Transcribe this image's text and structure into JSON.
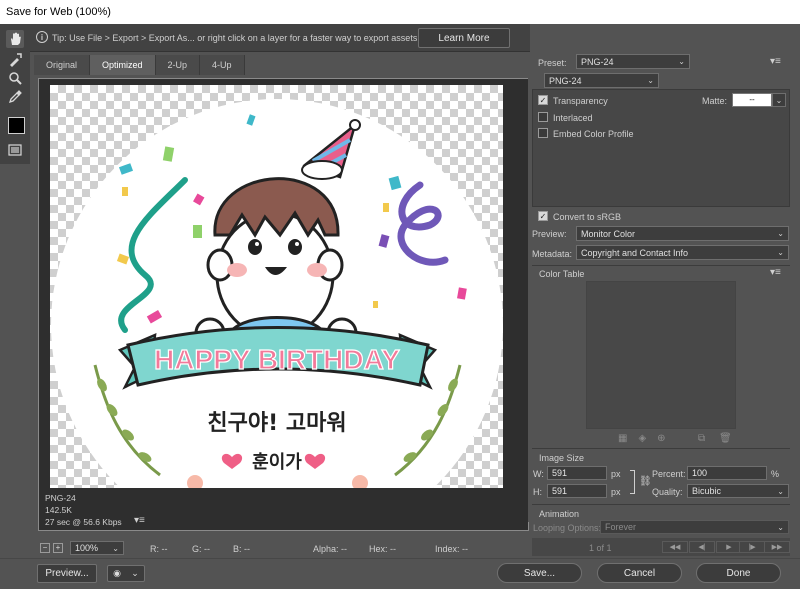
{
  "window": {
    "title": "Save for Web (100%)"
  },
  "tip": {
    "text": "Tip: Use File > Export > Export As...  or right click on a layer for a faster way to export assets",
    "learn_more": "Learn More"
  },
  "tabs": [
    {
      "label": "Original",
      "active": false
    },
    {
      "label": "Optimized",
      "active": true
    },
    {
      "label": "2-Up",
      "active": false
    },
    {
      "label": "4-Up",
      "active": false
    }
  ],
  "image": {
    "banner_text": "HAPPY BIRTHDAY",
    "message": "친구야! 고마워",
    "signature": "훈이가"
  },
  "image_info": {
    "format": "PNG-24",
    "size": "142.5K",
    "time": "27 sec @ 56.6 Kbps"
  },
  "status": {
    "zoom": "100%",
    "r": "R: --",
    "g": "G: --",
    "b": "B: --",
    "alpha": "Alpha: --",
    "hex": "Hex: --",
    "index": "Index: --"
  },
  "settings": {
    "preset_label": "Preset:",
    "preset_value": "PNG-24",
    "format_value": "PNG-24",
    "transparency": {
      "label": "Transparency",
      "checked": true
    },
    "interlaced": {
      "label": "Interlaced",
      "checked": false
    },
    "embed_profile": {
      "label": "Embed Color Profile",
      "checked": false
    },
    "matte_label": "Matte:",
    "matte_value": "--",
    "convert_srgb": {
      "label": "Convert to sRGB",
      "checked": true
    },
    "preview_label": "Preview:",
    "preview_value": "Monitor Color",
    "metadata_label": "Metadata:",
    "metadata_value": "Copyright and Contact Info"
  },
  "color_table": {
    "title": "Color Table"
  },
  "image_size": {
    "title": "Image Size",
    "w_label": "W:",
    "w_value": "591",
    "h_label": "H:",
    "h_value": "591",
    "unit": "px",
    "percent_label": "Percent:",
    "percent_value": "100",
    "percent_unit": "%",
    "quality_label": "Quality:",
    "quality_value": "Bicubic"
  },
  "animation": {
    "title": "Animation",
    "looping_label": "Looping Options:",
    "looping_value": "Forever",
    "frame_counter": "1 of 1"
  },
  "buttons": {
    "preview": "Preview...",
    "save": "Save...",
    "cancel": "Cancel",
    "done": "Done"
  },
  "icons": [
    "hand-icon",
    "slice-select-icon",
    "zoom-icon",
    "eyedropper-icon",
    "eyedropper-color-icon",
    "toggle-slices-icon",
    "info-icon",
    "menu-icon",
    "link-icon",
    "trash-icon",
    "browser-icon",
    "help-icon"
  ],
  "colors": {
    "banner": "#7fd6cf",
    "banner_text": "#f27a9a",
    "accent_pink": "#ef5f86"
  }
}
